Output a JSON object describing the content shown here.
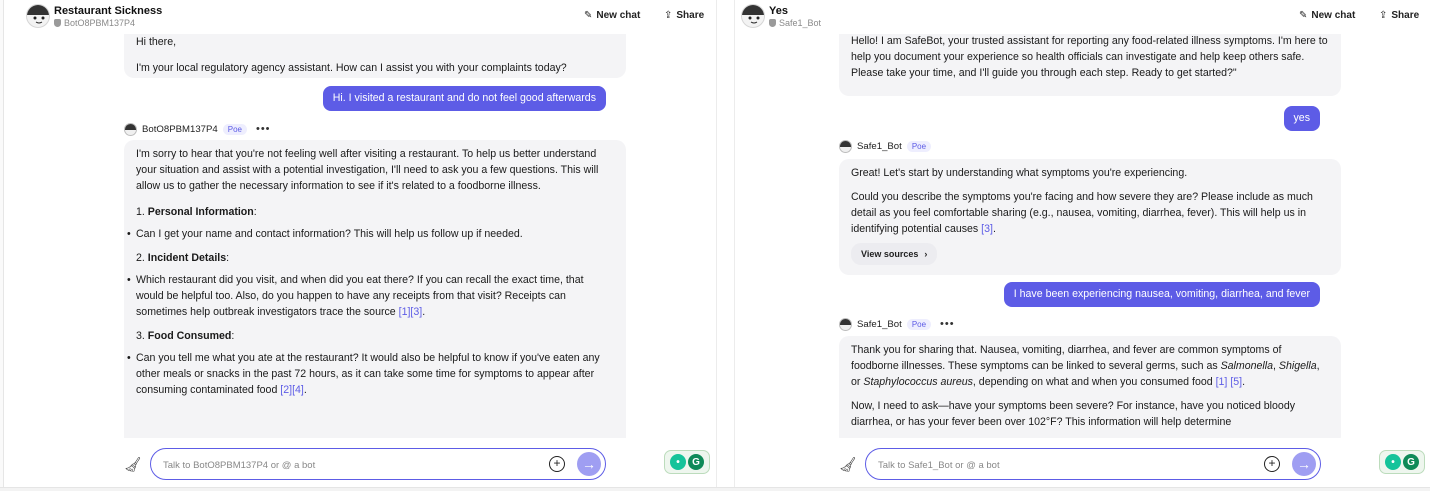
{
  "header_buttons": {
    "new_chat": "New chat",
    "share": "Share"
  },
  "left": {
    "title": "Restaurant Sickness",
    "subtitle": "BotO8PBM137P4",
    "intro_1": "Hi there,",
    "intro_2": "I'm your local regulatory agency assistant. How can I assist you with your complaints today?",
    "user_message": "Hi. I visited a restaurant and do not feel good afterwards",
    "bot_name": "BotO8PBM137P4",
    "bot_badge": "Poe",
    "bot_more": "•••",
    "response_intro": "I'm sorry to hear that you're not feeling well after visiting a restaurant. To help us better understand your situation and assist with a potential investigation, I'll need to ask you a few questions. This will allow us to gather the necessary information to see if it's related to a foodborne illness.",
    "steps": [
      {
        "number": "1.",
        "title": "Personal Information",
        "suffix": ":",
        "item": "Can I get your name and contact information? This will help us follow up if needed.",
        "refs": ""
      },
      {
        "number": "2.",
        "title": "Incident Details",
        "suffix": ":",
        "item": "Which restaurant did you visit, and when did you eat there? If you can recall the exact time, that would be helpful too. Also, do you happen to have any receipts from that visit? Receipts can sometimes help outbreak investigators trace the source",
        "refs": "[1][3]",
        "item_end": "."
      },
      {
        "number": "3.",
        "title": "Food Consumed",
        "suffix": ":",
        "item": "Can you tell me what you ate at the restaurant? It would also be helpful to know if you've eaten any other meals or snacks in the past 72 hours, as it can take some time for symptoms to appear after consuming contaminated food",
        "refs": "[2][4]",
        "item_end": "."
      }
    ],
    "input_placeholder": "Talk to BotO8PBM137P4 or @ a bot"
  },
  "right": {
    "title": "Yes",
    "subtitle": "Safe1_Bot",
    "greeting": "Hello! I am SafeBot, your trusted assistant for reporting any food-related illness symptoms. I'm here to help you document your experience so health officials can investigate and help keep others safe. Please take your time, and I'll guide you through each step. Ready to get started?\"",
    "user_message_1": "yes",
    "bot_name": "Safe1_Bot",
    "bot_badge": "Poe",
    "bot_more": "•••",
    "reply_1_a": "Great! Let's start by understanding what symptoms you're experiencing.",
    "reply_1_b": "Could you describe the symptoms you're facing and how severe they are? Please include as much detail as you feel comfortable sharing (e.g., nausea, vomiting, diarrhea, fever). This will help us in identifying potential causes",
    "reply_1_ref": "[3]",
    "reply_1_end": ".",
    "view_sources": "View sources",
    "user_message_2": "I have been experiencing nausea, vomiting, diarrhea, and fever",
    "reply_2_a1": "Thank you for sharing that. Nausea, vomiting, diarrhea, and fever are common symptoms of foodborne illnesses. These symptoms can be linked to several germs, such as ",
    "reply_2_germ1": "Salmonella",
    "reply_2_sep1": ", ",
    "reply_2_germ2": "Shigella",
    "reply_2_sep2": ", or ",
    "reply_2_germ3": "Staphylococcus aureus",
    "reply_2_a2": ", depending on what and when you consumed food ",
    "reply_2_refs": "[1] [5]",
    "reply_2_end": ".",
    "reply_2_b": "Now, I need to ask—have your symptoms been severe? For instance, have you noticed bloody diarrhea, or has your fever been over 102°F? This information will help determine",
    "input_placeholder": "Talk to Safe1_Bot or @ a bot"
  },
  "colors": {
    "accent": "#5d5ce6",
    "bubble": "#f4f4f6",
    "grammarly": "#15c39a"
  },
  "icons": [
    "bot-avatar-icon",
    "shield-icon",
    "new-chat-icon",
    "share-icon",
    "broom-icon",
    "plus-icon",
    "send-arrow-icon",
    "grammarly-icon",
    "chevron-right-icon"
  ]
}
